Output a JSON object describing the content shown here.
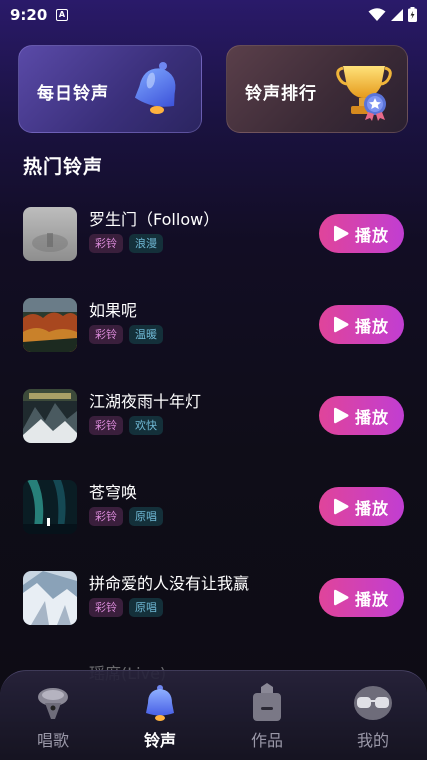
{
  "status_bar": {
    "time": "9:20",
    "notification_icon": "a-icon",
    "icons": [
      "wifi-icon",
      "signal-icon",
      "battery-icon"
    ]
  },
  "feature_cards": [
    {
      "label": "每日铃声",
      "icon": "bell-icon"
    },
    {
      "label": "铃声排行",
      "icon": "trophy-icon"
    }
  ],
  "section_title": "热门铃声",
  "songs": [
    {
      "title": "罗生门（Follow）",
      "tags": [
        "彩铃",
        "浪漫"
      ],
      "play_label": "播放",
      "cover": "misty-grey-cover"
    },
    {
      "title": "如果呢",
      "tags": [
        "彩铃",
        "温暖"
      ],
      "play_label": "播放",
      "cover": "autumn-forest-cover"
    },
    {
      "title": "江湖夜雨十年灯",
      "tags": [
        "彩铃",
        "欢快"
      ],
      "play_label": "播放",
      "cover": "mountain-art-cover"
    },
    {
      "title": "苍穹唤",
      "tags": [
        "彩铃",
        "原唱"
      ],
      "play_label": "播放",
      "cover": "aurora-night-cover"
    },
    {
      "title": "拼命爱的人没有让我赢",
      "tags": [
        "彩铃",
        "原唱"
      ],
      "play_label": "播放",
      "cover": "snowy-mountain-cover"
    }
  ],
  "partial_song_title": "瑶席(Live)",
  "tabs": [
    {
      "label": "唱歌",
      "icon": "microphone-icon",
      "active": false
    },
    {
      "label": "铃声",
      "icon": "bell-icon",
      "active": true
    },
    {
      "label": "作品",
      "icon": "folder-icon",
      "active": false
    },
    {
      "label": "我的",
      "icon": "glasses-icon",
      "active": false
    }
  ],
  "colors": {
    "play_gradient_start": "#e0449a",
    "play_gradient_end": "#c13ed2",
    "tag_pink": "#d98ad8",
    "tag_blue": "#6fb8d4"
  }
}
